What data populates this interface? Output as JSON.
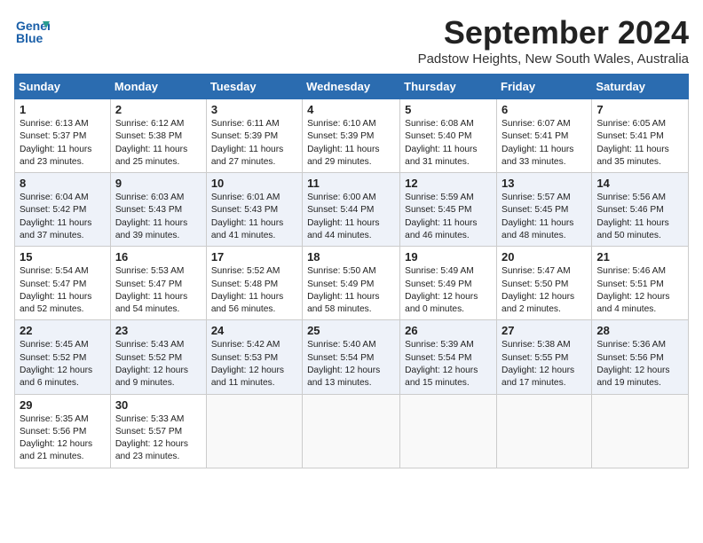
{
  "header": {
    "logo_line1": "General",
    "logo_line2": "Blue",
    "month_year": "September 2024",
    "location": "Padstow Heights, New South Wales, Australia"
  },
  "days_of_week": [
    "Sunday",
    "Monday",
    "Tuesday",
    "Wednesday",
    "Thursday",
    "Friday",
    "Saturday"
  ],
  "weeks": [
    [
      {
        "day": "1",
        "sunrise": "Sunrise: 6:13 AM",
        "sunset": "Sunset: 5:37 PM",
        "daylight": "Daylight: 11 hours and 23 minutes."
      },
      {
        "day": "2",
        "sunrise": "Sunrise: 6:12 AM",
        "sunset": "Sunset: 5:38 PM",
        "daylight": "Daylight: 11 hours and 25 minutes."
      },
      {
        "day": "3",
        "sunrise": "Sunrise: 6:11 AM",
        "sunset": "Sunset: 5:39 PM",
        "daylight": "Daylight: 11 hours and 27 minutes."
      },
      {
        "day": "4",
        "sunrise": "Sunrise: 6:10 AM",
        "sunset": "Sunset: 5:39 PM",
        "daylight": "Daylight: 11 hours and 29 minutes."
      },
      {
        "day": "5",
        "sunrise": "Sunrise: 6:08 AM",
        "sunset": "Sunset: 5:40 PM",
        "daylight": "Daylight: 11 hours and 31 minutes."
      },
      {
        "day": "6",
        "sunrise": "Sunrise: 6:07 AM",
        "sunset": "Sunset: 5:41 PM",
        "daylight": "Daylight: 11 hours and 33 minutes."
      },
      {
        "day": "7",
        "sunrise": "Sunrise: 6:05 AM",
        "sunset": "Sunset: 5:41 PM",
        "daylight": "Daylight: 11 hours and 35 minutes."
      }
    ],
    [
      {
        "day": "8",
        "sunrise": "Sunrise: 6:04 AM",
        "sunset": "Sunset: 5:42 PM",
        "daylight": "Daylight: 11 hours and 37 minutes."
      },
      {
        "day": "9",
        "sunrise": "Sunrise: 6:03 AM",
        "sunset": "Sunset: 5:43 PM",
        "daylight": "Daylight: 11 hours and 39 minutes."
      },
      {
        "day": "10",
        "sunrise": "Sunrise: 6:01 AM",
        "sunset": "Sunset: 5:43 PM",
        "daylight": "Daylight: 11 hours and 41 minutes."
      },
      {
        "day": "11",
        "sunrise": "Sunrise: 6:00 AM",
        "sunset": "Sunset: 5:44 PM",
        "daylight": "Daylight: 11 hours and 44 minutes."
      },
      {
        "day": "12",
        "sunrise": "Sunrise: 5:59 AM",
        "sunset": "Sunset: 5:45 PM",
        "daylight": "Daylight: 11 hours and 46 minutes."
      },
      {
        "day": "13",
        "sunrise": "Sunrise: 5:57 AM",
        "sunset": "Sunset: 5:45 PM",
        "daylight": "Daylight: 11 hours and 48 minutes."
      },
      {
        "day": "14",
        "sunrise": "Sunrise: 5:56 AM",
        "sunset": "Sunset: 5:46 PM",
        "daylight": "Daylight: 11 hours and 50 minutes."
      }
    ],
    [
      {
        "day": "15",
        "sunrise": "Sunrise: 5:54 AM",
        "sunset": "Sunset: 5:47 PM",
        "daylight": "Daylight: 11 hours and 52 minutes."
      },
      {
        "day": "16",
        "sunrise": "Sunrise: 5:53 AM",
        "sunset": "Sunset: 5:47 PM",
        "daylight": "Daylight: 11 hours and 54 minutes."
      },
      {
        "day": "17",
        "sunrise": "Sunrise: 5:52 AM",
        "sunset": "Sunset: 5:48 PM",
        "daylight": "Daylight: 11 hours and 56 minutes."
      },
      {
        "day": "18",
        "sunrise": "Sunrise: 5:50 AM",
        "sunset": "Sunset: 5:49 PM",
        "daylight": "Daylight: 11 hours and 58 minutes."
      },
      {
        "day": "19",
        "sunrise": "Sunrise: 5:49 AM",
        "sunset": "Sunset: 5:49 PM",
        "daylight": "Daylight: 12 hours and 0 minutes."
      },
      {
        "day": "20",
        "sunrise": "Sunrise: 5:47 AM",
        "sunset": "Sunset: 5:50 PM",
        "daylight": "Daylight: 12 hours and 2 minutes."
      },
      {
        "day": "21",
        "sunrise": "Sunrise: 5:46 AM",
        "sunset": "Sunset: 5:51 PM",
        "daylight": "Daylight: 12 hours and 4 minutes."
      }
    ],
    [
      {
        "day": "22",
        "sunrise": "Sunrise: 5:45 AM",
        "sunset": "Sunset: 5:52 PM",
        "daylight": "Daylight: 12 hours and 6 minutes."
      },
      {
        "day": "23",
        "sunrise": "Sunrise: 5:43 AM",
        "sunset": "Sunset: 5:52 PM",
        "daylight": "Daylight: 12 hours and 9 minutes."
      },
      {
        "day": "24",
        "sunrise": "Sunrise: 5:42 AM",
        "sunset": "Sunset: 5:53 PM",
        "daylight": "Daylight: 12 hours and 11 minutes."
      },
      {
        "day": "25",
        "sunrise": "Sunrise: 5:40 AM",
        "sunset": "Sunset: 5:54 PM",
        "daylight": "Daylight: 12 hours and 13 minutes."
      },
      {
        "day": "26",
        "sunrise": "Sunrise: 5:39 AM",
        "sunset": "Sunset: 5:54 PM",
        "daylight": "Daylight: 12 hours and 15 minutes."
      },
      {
        "day": "27",
        "sunrise": "Sunrise: 5:38 AM",
        "sunset": "Sunset: 5:55 PM",
        "daylight": "Daylight: 12 hours and 17 minutes."
      },
      {
        "day": "28",
        "sunrise": "Sunrise: 5:36 AM",
        "sunset": "Sunset: 5:56 PM",
        "daylight": "Daylight: 12 hours and 19 minutes."
      }
    ],
    [
      {
        "day": "29",
        "sunrise": "Sunrise: 5:35 AM",
        "sunset": "Sunset: 5:56 PM",
        "daylight": "Daylight: 12 hours and 21 minutes."
      },
      {
        "day": "30",
        "sunrise": "Sunrise: 5:33 AM",
        "sunset": "Sunset: 5:57 PM",
        "daylight": "Daylight: 12 hours and 23 minutes."
      },
      null,
      null,
      null,
      null,
      null
    ]
  ]
}
